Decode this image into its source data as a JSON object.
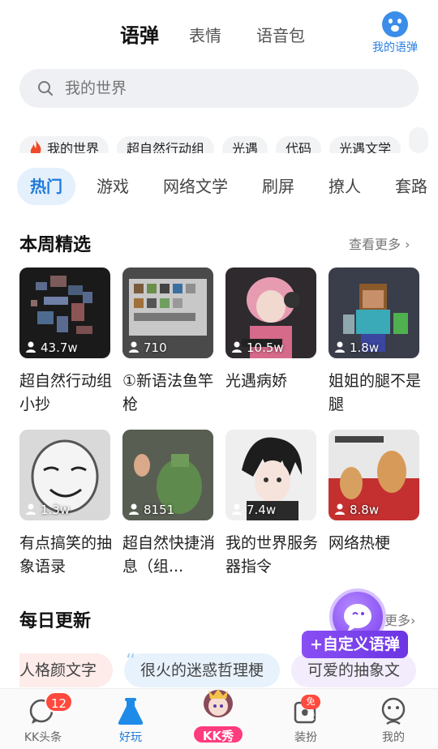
{
  "header": {
    "tabs": [
      {
        "label": "语弹",
        "active": true
      },
      {
        "label": "表情",
        "active": false
      },
      {
        "label": "语音包",
        "active": false
      }
    ],
    "mine_label": "我的语弹"
  },
  "search": {
    "placeholder": "我的世界"
  },
  "chips": [
    "我的世界",
    "超自然行动组",
    "光遇",
    "代码",
    "光遇文学",
    ""
  ],
  "categories": [
    {
      "label": "热门",
      "active": true
    },
    {
      "label": "游戏"
    },
    {
      "label": "网络文学"
    },
    {
      "label": "刷屏"
    },
    {
      "label": "撩人"
    },
    {
      "label": "套路"
    }
  ],
  "weekly": {
    "title": "本周精选",
    "more": "查看更多",
    "cards": [
      {
        "title": "超自然行动组小抄",
        "count": "43.7w"
      },
      {
        "title": "①新语法鱼竿枪",
        "count": "710"
      },
      {
        "title": "光遇病娇",
        "count": "10.5w"
      },
      {
        "title": "姐姐的腿不是腿",
        "count": "1.8w"
      },
      {
        "title": "有点搞笑的抽象语录",
        "count": "1.3w"
      },
      {
        "title": "超自然快捷消息（组...",
        "count": "8151"
      },
      {
        "title": "我的世界服务器指令",
        "count": "7.4w"
      },
      {
        "title": "网络热梗",
        "count": "8.8w"
      }
    ]
  },
  "daily": {
    "title": "每日更新",
    "more": "更多",
    "chips": [
      "人格颜文字",
      "很火的迷惑哲理梗",
      "可爱的抽象文"
    ]
  },
  "fab": {
    "label": "+自定义语弹"
  },
  "nav": {
    "items": [
      {
        "label": "KK头条",
        "badge": "12"
      },
      {
        "label": "好玩",
        "active": true
      },
      {
        "label": "KK秀"
      },
      {
        "label": "装扮",
        "tag": "免费"
      },
      {
        "label": "我的"
      }
    ]
  },
  "colors": {
    "accent": "#1f7ad9",
    "highlight": "#ffe033",
    "fab": "#7a3ef0",
    "badge": "#ff4a3d"
  }
}
